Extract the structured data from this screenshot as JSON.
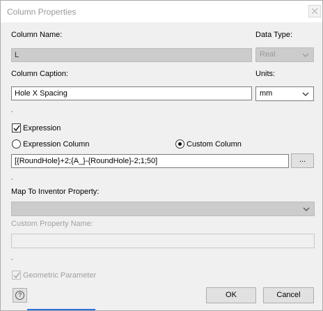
{
  "window": {
    "title": "Column Properties",
    "accent_color": "#2a6fd6"
  },
  "column_name": {
    "label": "Column Name:",
    "value": "L"
  },
  "data_type": {
    "label": "Data Type:",
    "value": "Real"
  },
  "column_caption": {
    "label": "Column Caption:",
    "value": "Hole X Spacing"
  },
  "units": {
    "label": "Units:",
    "value": "mm"
  },
  "expression": {
    "checkbox_label": "Expression",
    "checked": true,
    "radio_expression_column": "Expression Column",
    "radio_custom_column": "Custom Column",
    "selected": "Custom Column",
    "value": "[{RoundHole}+2;{A_}-{RoundHole}-2;1;50]",
    "browse_label": "..."
  },
  "inventor_property": {
    "label": "Map To Inventor Property:",
    "value": ""
  },
  "custom_property": {
    "label": "Custom Property Name:",
    "value": ""
  },
  "geometric_parameter": {
    "label": "Geometric Parameter",
    "checked": true,
    "enabled": false
  },
  "buttons": {
    "help_symbol": "?",
    "ok": "OK",
    "cancel": "Cancel"
  },
  "icons": {
    "close": "close-icon",
    "help": "help-icon",
    "dropdown": "chevron-down-icon",
    "check": "checkmark-icon"
  }
}
